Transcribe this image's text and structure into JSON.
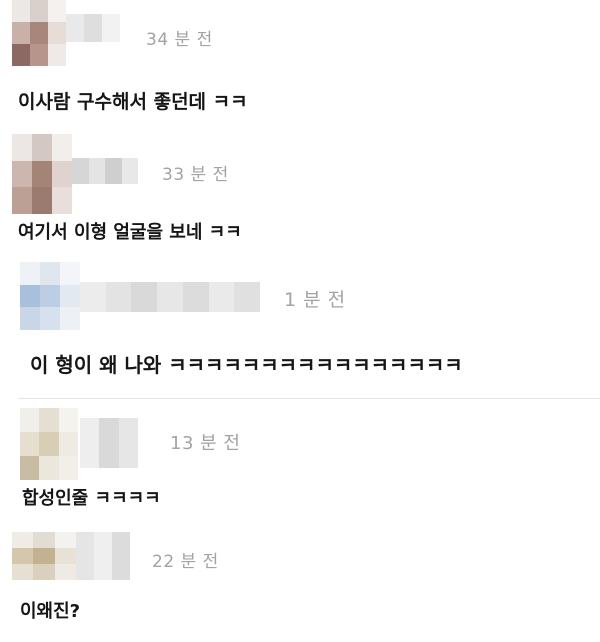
{
  "comments": [
    {
      "time": "34 분 전",
      "text": "이사람 구수해서 좋던데 ㅋㅋ",
      "avatar_icon": "blurred-avatar",
      "avatar_colors": [
        "#ece8e6",
        "#d9cfcb",
        "#f4f1ef",
        "#c9b0a8",
        "#a8867c",
        "#e6dcd8",
        "#8a6a63",
        "#b7958c",
        "#efe9e7"
      ],
      "nick_colors": [
        "#e9e9e9",
        "#dedede",
        "#f2f2f2"
      ]
    },
    {
      "time": "33 분 전",
      "text": "여기서 이형 얼굴을 보네 ㅋㅋ",
      "avatar_icon": "blurred-avatar",
      "avatar_colors": [
        "#ece7e5",
        "#d4c8c4",
        "#f1eeec",
        "#cdb6ae",
        "#a58478",
        "#e0d3cf",
        "#bc9f95",
        "#9b7b70",
        "#e8dfdc"
      ],
      "nick_colors": [
        "#d6d6d6",
        "#e4e4e4",
        "#cfcfcf",
        "#e8e8e8"
      ]
    },
    {
      "time": "1 분 전",
      "text": "이 형이 왜 나와 ㅋㅋㅋㅋㅋㅋㅋㅋㅋㅋㅋㅋㅋㅋㅋㅋ",
      "avatar_icon": "blurred-avatar",
      "avatar_colors": [
        "#eef1f5",
        "#dfe6ee",
        "#f3f5f8",
        "#a9c0dc",
        "#bccde4",
        "#e3e9f0",
        "#c8d6e8",
        "#d7e1ed",
        "#edf1f6"
      ],
      "nick_colors": [
        "#ececec",
        "#e3e3e3",
        "#d9d9d9",
        "#e7e7e7",
        "#dcdcdc",
        "#eaeaea",
        "#e0e0e0"
      ]
    },
    {
      "time": "13 분 전",
      "text": "합성인줄 ㅋㅋㅋㅋ",
      "avatar_icon": "blurred-avatar",
      "avatar_colors": [
        "#f1efe9",
        "#e4dfd2",
        "#f5f3ee",
        "#e6dfcf",
        "#d8cdb5",
        "#efebe2",
        "#c8bda3",
        "#ece7dc",
        "#f2efe9"
      ],
      "nick_colors": [
        "#eeeeee",
        "#d9d9d9",
        "#e6e6e6"
      ]
    },
    {
      "time": "22 분 전",
      "text": "이왜진?",
      "avatar_icon": "blurred-avatar",
      "avatar_colors": [
        "#efece6",
        "#e2ddd2",
        "#f4f2ee",
        "#d4c7ab",
        "#c3b28f",
        "#e8e2d6",
        "#e6e0d2",
        "#d9d0bd",
        "#efebe4"
      ],
      "nick_colors": [
        "#e5e5e5",
        "#efefef",
        "#dcdcdc"
      ]
    }
  ]
}
